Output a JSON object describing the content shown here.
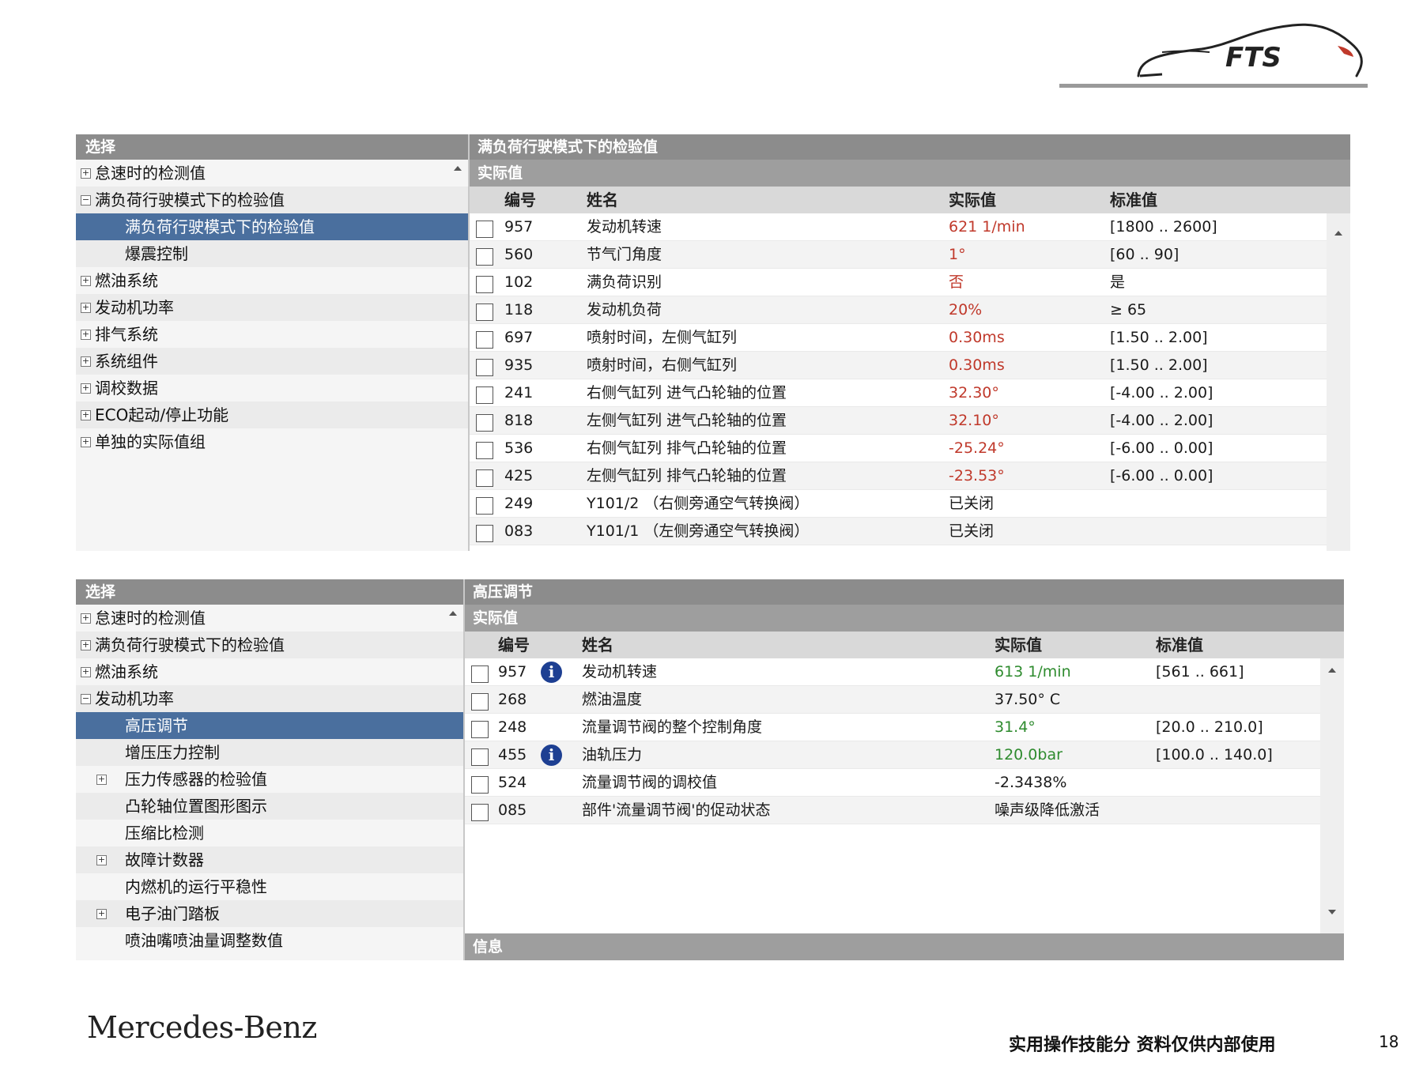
{
  "logo": {
    "text": "FTS",
    "accent": "#c0392b"
  },
  "panel1": {
    "nav": {
      "title": "选择",
      "items": [
        {
          "label": "怠速时的检测值",
          "expander": "+",
          "level": 0
        },
        {
          "label": "满负荷行驶模式下的检验值",
          "expander": "−",
          "level": 0
        },
        {
          "label": "满负荷行驶模式下的检验值",
          "expander": "",
          "level": 1,
          "selected": true
        },
        {
          "label": "爆震控制",
          "expander": "",
          "level": 1
        },
        {
          "label": "燃油系统",
          "expander": "+",
          "level": 0
        },
        {
          "label": "发动机功率",
          "expander": "+",
          "level": 0
        },
        {
          "label": "排气系统",
          "expander": "+",
          "level": 0
        },
        {
          "label": "系统组件",
          "expander": "+",
          "level": 0
        },
        {
          "label": "调校数据",
          "expander": "+",
          "level": 0
        },
        {
          "label": "ECO起动/停止功能",
          "expander": "+",
          "level": 0
        },
        {
          "label": "单独的实际值组",
          "expander": "+",
          "level": 0
        }
      ]
    },
    "main": {
      "title": "满负荷行驶模式下的检验值",
      "subtitle": "实际值",
      "columns": {
        "id": "编号",
        "name": "姓名",
        "actual": "实际值",
        "standard": "标准值"
      },
      "rows": [
        {
          "id": "957",
          "name": "发动机转速",
          "actual": "621 1/min",
          "standard": "[1800 .. 2600]",
          "color": "red"
        },
        {
          "id": "560",
          "name": "节气门角度",
          "actual": "1°",
          "standard": "[60 .. 90]",
          "color": "red"
        },
        {
          "id": "102",
          "name": "满负荷识别",
          "actual": "否",
          "standard": "是",
          "color": "red"
        },
        {
          "id": "118",
          "name": "发动机负荷",
          "actual": "20%",
          "standard": "≥ 65",
          "color": "red"
        },
        {
          "id": "697",
          "name": "喷射时间，左侧气缸列",
          "actual": "0.30ms",
          "standard": "[1.50 .. 2.00]",
          "color": "red"
        },
        {
          "id": "935",
          "name": "喷射时间，右侧气缸列",
          "actual": "0.30ms",
          "standard": "[1.50 .. 2.00]",
          "color": "red"
        },
        {
          "id": "241",
          "name": "右侧气缸列 进气凸轮轴的位置",
          "actual": "32.30°",
          "standard": "[-4.00 .. 2.00]",
          "color": "red"
        },
        {
          "id": "818",
          "name": "左侧气缸列 进气凸轮轴的位置",
          "actual": "32.10°",
          "standard": "[-4.00 .. 2.00]",
          "color": "red"
        },
        {
          "id": "536",
          "name": "右侧气缸列 排气凸轮轴的位置",
          "actual": "-25.24°",
          "standard": "[-6.00 .. 0.00]",
          "color": "red"
        },
        {
          "id": "425",
          "name": "左侧气缸列 排气凸轮轴的位置",
          "actual": "-23.53°",
          "standard": "[-6.00 .. 0.00]",
          "color": "red"
        },
        {
          "id": "249",
          "name": "Y101/2 （右侧旁通空气转换阀）",
          "actual": "已关闭",
          "standard": "",
          "color": ""
        },
        {
          "id": "083",
          "name": "Y101/1 （左侧旁通空气转换阀）",
          "actual": "已关闭",
          "standard": "",
          "color": ""
        }
      ]
    }
  },
  "panel2": {
    "nav": {
      "title": "选择",
      "items": [
        {
          "label": "怠速时的检测值",
          "expander": "+",
          "level": 0
        },
        {
          "label": "满负荷行驶模式下的检验值",
          "expander": "+",
          "level": 0
        },
        {
          "label": "燃油系统",
          "expander": "+",
          "level": 0
        },
        {
          "label": "发动机功率",
          "expander": "−",
          "level": 0
        },
        {
          "label": "高压调节",
          "expander": "",
          "level": 1,
          "selected": true
        },
        {
          "label": "增压压力控制",
          "expander": "",
          "level": 1
        },
        {
          "label": "压力传感器的检验值",
          "expander": "+",
          "level": 1
        },
        {
          "label": "凸轮轴位置图形图示",
          "expander": "",
          "level": 1
        },
        {
          "label": "压缩比检测",
          "expander": "",
          "level": 1
        },
        {
          "label": "故障计数器",
          "expander": "+",
          "level": 1
        },
        {
          "label": "内燃机的运行平稳性",
          "expander": "",
          "level": 1
        },
        {
          "label": "电子油门踏板",
          "expander": "+",
          "level": 1
        },
        {
          "label": "喷油嘴喷油量调整数值",
          "expander": "",
          "level": 1
        }
      ]
    },
    "main": {
      "title": "高压调节",
      "subtitle": "实际值",
      "info_label": "信息",
      "columns": {
        "id": "编号",
        "name": "姓名",
        "actual": "实际值",
        "standard": "标准值"
      },
      "rows": [
        {
          "id": "957",
          "info": true,
          "name": "发动机转速",
          "actual": "613 1/min",
          "standard": "[561 .. 661]",
          "color": "green"
        },
        {
          "id": "268",
          "info": false,
          "name": "燃油温度",
          "actual": "37.50° C",
          "standard": "",
          "color": ""
        },
        {
          "id": "248",
          "info": false,
          "name": "流量调节阀的整个控制角度",
          "actual": "31.4°",
          "standard": "[20.0 .. 210.0]",
          "color": "green"
        },
        {
          "id": "455",
          "info": true,
          "name": "油轨压力",
          "actual": "120.0bar",
          "standard": "[100.0 .. 140.0]",
          "color": "green"
        },
        {
          "id": "524",
          "info": false,
          "name": "流量调节阀的调校值",
          "actual": "-2.3438%",
          "standard": "",
          "color": ""
        },
        {
          "id": "085",
          "info": false,
          "name": "部件'流量调节阀'的促动状态",
          "actual": "噪声级降低激活",
          "standard": "",
          "color": ""
        }
      ]
    }
  },
  "footer": {
    "brand": "Mercedes-Benz",
    "note": "实用操作技能分 资料仅供内部使用",
    "page": "18"
  }
}
